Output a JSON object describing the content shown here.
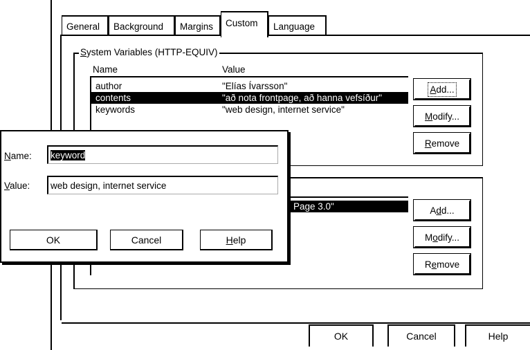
{
  "tabs": [
    {
      "label": "General"
    },
    {
      "label": "Background"
    },
    {
      "label": "Margins"
    },
    {
      "label": "Custom"
    },
    {
      "label": "Language"
    }
  ],
  "system_group": {
    "title_mnemonic": "S",
    "title_rest": "ystem Variables (HTTP-EQUIV)",
    "col_name": "Name",
    "col_value": "Value",
    "rows": [
      {
        "name": "author",
        "value": "\"Elías Ívarsson\""
      },
      {
        "name": "contents",
        "value": "\"að nota frontpage, að hanna vefsíður\""
      },
      {
        "name": "keywords",
        "value": "\"web design, internet service\""
      }
    ],
    "add_pre": "",
    "add_mn": "A",
    "add_post": "dd...",
    "modify_mn": "M",
    "modify_post": "odify...",
    "remove_mn": "R",
    "remove_post": "emove"
  },
  "user_group": {
    "visible_value": "Page 3.0\"",
    "add_pre": "A",
    "add_mn": "d",
    "add_post": "d...",
    "modify_pre": "M",
    "modify_mn": "o",
    "modify_post": "dify...",
    "remove_pre": "R",
    "remove_mn": "e",
    "remove_post": "move"
  },
  "footer": {
    "ok": "OK",
    "cancel": "Cancel",
    "help": "Help"
  },
  "dialog": {
    "name_mn": "N",
    "name_post": "ame:",
    "name_value": "keyword",
    "value_mn": "V",
    "value_post": "alue:",
    "value_value": "web design, internet service",
    "ok": "OK",
    "cancel": "Cancel",
    "help_mn": "H",
    "help_post": "elp"
  }
}
